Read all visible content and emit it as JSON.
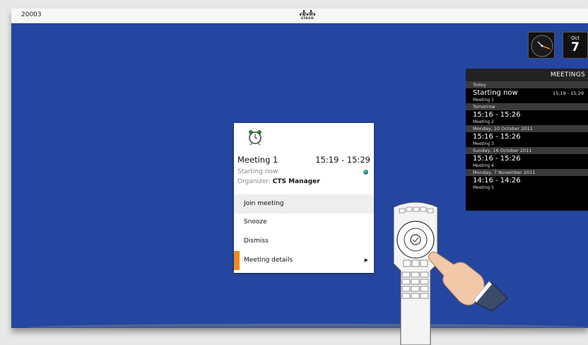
{
  "topbar": {
    "system_number": "20003",
    "logo_text": "cisco"
  },
  "calendar": {
    "month": "Oct",
    "day": "7"
  },
  "meetings_panel": {
    "title": "MEETINGS",
    "groups": [
      {
        "day": "Today",
        "meetings": [
          {
            "time": "Starting now",
            "name": "Meeting 1",
            "range": "15:19 - 15:29"
          }
        ]
      },
      {
        "day": "Tomorrow",
        "meetings": [
          {
            "time": "15:16 - 15:26",
            "name": "Meeting 2"
          }
        ]
      },
      {
        "day": "Monday, 10 October 2011",
        "meetings": [
          {
            "time": "15:16 - 15:26",
            "name": "Meeting 3"
          }
        ]
      },
      {
        "day": "Sunday, 16 October 2011",
        "meetings": [
          {
            "time": "15:16 - 15:26",
            "name": "Meeting 4"
          }
        ]
      },
      {
        "day": "Monday, 7 November 2011",
        "meetings": [
          {
            "time": "14:16 - 14:26",
            "name": "Meeting 5"
          }
        ]
      }
    ]
  },
  "dialog": {
    "title": "Meeting 1",
    "time": "15:19 - 15:29",
    "status": "Starting now",
    "organizer_label": "Organizer:",
    "organizer_name": "CTS Manager",
    "menu": {
      "join": "Join meeting",
      "snooze": "Snooze",
      "dismiss": "Dismiss",
      "details": "Meeting details"
    }
  },
  "colors": {
    "screen_background": "#2446a0",
    "accent": "#f08a1c"
  }
}
